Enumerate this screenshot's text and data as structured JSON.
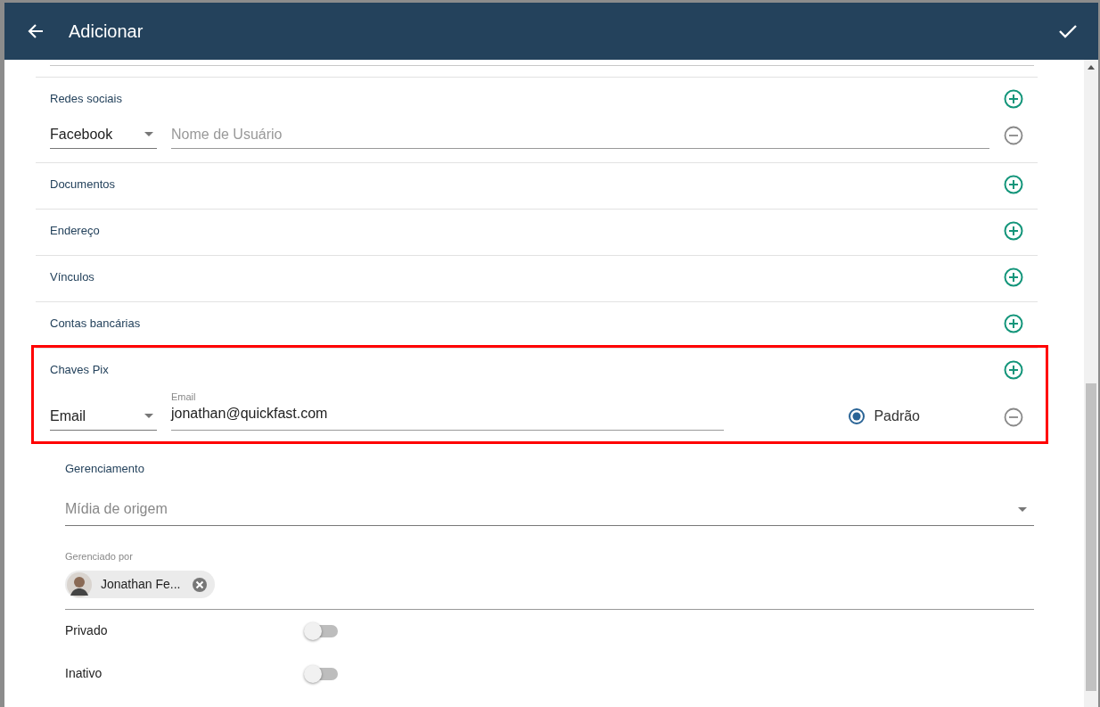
{
  "header": {
    "title": "Adicionar"
  },
  "sections": [
    {
      "title": "Redes sociais",
      "highlighted": false,
      "entries": [
        {
          "type_select": "Facebook",
          "field": {
            "placeholder": "Nome de Usuário"
          }
        }
      ]
    },
    {
      "title": "Documentos",
      "highlighted": false
    },
    {
      "title": "Endereço",
      "highlighted": false
    },
    {
      "title": "Vínculos",
      "highlighted": false
    },
    {
      "title": "Contas bancárias",
      "highlighted": false
    },
    {
      "title": "Chaves Pix",
      "highlighted": true,
      "entries": [
        {
          "type_select": "Email",
          "field": {
            "label": "Email",
            "value": "jonathan@quickfast.com"
          },
          "default_radio": {
            "label": "Padrão",
            "selected": true
          }
        }
      ]
    }
  ],
  "management": {
    "title": "Gerenciamento",
    "origin_select": {
      "placeholder": "Mídia de origem"
    },
    "managed_by": {
      "label": "Gerenciado por",
      "chips": [
        {
          "text": "Jonathan Fe..."
        }
      ]
    },
    "toggles": [
      {
        "label": "Privado",
        "on": false
      },
      {
        "label": "Inativo",
        "on": false
      }
    ]
  }
}
